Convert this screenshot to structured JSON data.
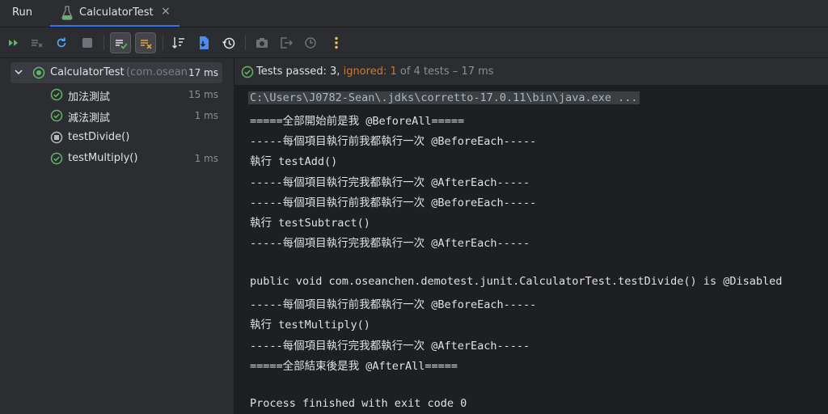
{
  "header": {
    "run_label": "Run",
    "tab_title": "CalculatorTest",
    "tab_close": "×"
  },
  "toolbar": {
    "buttons": [
      "rerun-all-icon",
      "rerun-failed-icon",
      "rerun-icon",
      "stop-icon",
      "show-passed-icon",
      "show-ignored-icon",
      "sort-icon",
      "import-icon",
      "history-icon",
      "screenshot-icon",
      "export-icon",
      "coverage-icon",
      "more-icon"
    ]
  },
  "tree": {
    "root": {
      "label": "CalculatorTest",
      "package": "(com.oseanchen",
      "duration": "17 ms"
    },
    "items": [
      {
        "label": "加法測試",
        "duration": "15 ms",
        "status": "passed"
      },
      {
        "label": "減法測試",
        "duration": "1 ms",
        "status": "passed"
      },
      {
        "label": "testDivide()",
        "duration": "",
        "status": "ignored"
      },
      {
        "label": "testMultiply()",
        "duration": "1 ms",
        "status": "passed"
      }
    ]
  },
  "status": {
    "passed": "Tests passed: 3,",
    "ignored": "ignored: 1",
    "rest": "of 4 tests – 17 ms"
  },
  "console": {
    "lines": [
      "C:\\Users\\J0782-Sean\\.jdks\\corretto-17.0.11\\bin\\java.exe ...",
      "=====全部開始前是我 @BeforeAll=====",
      "-----每個項目執行前我都執行一次 @BeforeEach-----",
      "執行 testAdd()",
      "-----每個項目執行完我都執行一次 @AfterEach-----",
      "-----每個項目執行前我都執行一次 @BeforeEach-----",
      "執行 testSubtract()",
      "-----每個項目執行完我都執行一次 @AfterEach-----",
      "",
      "public void com.oseanchen.demotest.junit.CalculatorTest.testDivide() is @Disabled",
      "-----每個項目執行前我都執行一次 @BeforeEach-----",
      "執行 testMultiply()",
      "-----每個項目執行完我都執行一次 @AfterEach-----",
      "=====全部結束後是我 @AfterAll=====",
      "",
      "Process finished with exit code 0"
    ]
  },
  "colors": {
    "pass": "#5fb865",
    "ignored": "#c77d2e",
    "accent": "#3574f0"
  }
}
